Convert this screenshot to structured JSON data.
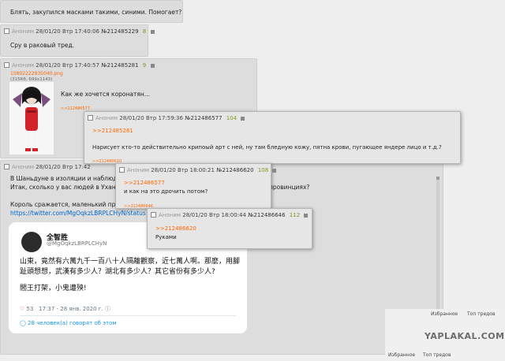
{
  "top_post": {
    "text": "Блять, закупился масками такими, синими. Помогает?"
  },
  "post2": {
    "author": "Аноним",
    "date": "28/01/20 Втр 17:40:06",
    "num": "№212485229",
    "count": "8",
    "text": "Сру в раковый тред."
  },
  "post3": {
    "author": "Аноним",
    "date": "28/01/20 Втр 17:40:57",
    "num": "№212485281",
    "count": "9",
    "file_name": "15802222935040.png",
    "file_info": "(315Кб, 699x1143)",
    "text": "Как же хочется коронатян...",
    "backlink": ">>212486577"
  },
  "pop1": {
    "author": "Аноним",
    "date": "28/01/20 Втр 17:59:36",
    "num": "№212486577",
    "count": "104",
    "reply": ">>212485281",
    "text": "Нарисует кто-то действительно крипоый арт с ней, ну там бледную кожу, пятна крови, пугающее яндере лицо и т.д.?",
    "backlink": ">>212486620"
  },
  "post4": {
    "author": "Аноним",
    "date": "28/01/20 Втр 17:42",
    "line1": "В Шаньдуне в изоляции и наблюде",
    "line2": "Итак, сколько у вас людей в Ухане",
    "line2_end": "провинциях?",
    "line3": "Король сражается, маленький приз",
    "link": "https://twitter.com/MgOqkzLBRPLCHyN/status"
  },
  "pop2": {
    "author": "Аноним",
    "date": "28/01/20 Втр 18:00:21",
    "num": "№212486620",
    "count": "108",
    "reply": ">>212486577",
    "text": "и как на это дрочить потом?",
    "backlink": ">>212486646"
  },
  "pop3": {
    "author": "Аноним",
    "date": "28/01/20 Втр 18:00:44",
    "num": "№212486646",
    "count": "112",
    "reply": ">>212486620",
    "text": "Руками"
  },
  "tweet": {
    "name": "全智胜",
    "handle": "@MgOqkzLBRPLCHyN",
    "p1": "山東，竟然有六萬九千一百八十人隔離觀察，近七萬人啊。那麼，用腳趾頭想想，武漢有多少人？湖北有多少人？其它省份有多少人?",
    "p2": "閻王打架，小鬼遭殃!",
    "likes": "53",
    "time": "17:37 - 28 янв. 2020 г.",
    "people": "28 человек(а) говорят об этом"
  },
  "corner": {
    "fav": "Избранное",
    "top": "Топ тредов",
    "watermark": "YAPLAKAL.COM"
  }
}
